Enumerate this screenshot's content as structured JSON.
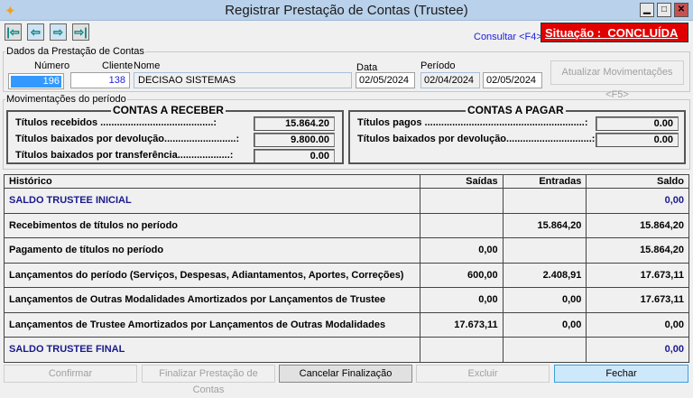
{
  "window": {
    "title": "Registrar Prestação de Contas (Trustee)",
    "minimize": "▁",
    "maximize": "□",
    "close": "✕"
  },
  "nav": {
    "first": "|⇦",
    "prev": "⇦",
    "next": "⇨",
    "last": "⇨|"
  },
  "consultar": "Consultar <F4>",
  "situacao": {
    "label": "Situação :",
    "value": "CONCLUÍDA",
    "color": "#e00000"
  },
  "dados": {
    "group": "Dados da Prestação de Contas",
    "numero_label": "Número",
    "numero": "196",
    "cliente_label": "Cliente",
    "cliente": "138",
    "nome_label": "Nome",
    "nome": "DECISAO SISTEMAS",
    "data_label": "Data",
    "data": "02/05/2024",
    "periodo_label": "Período",
    "periodo_ini": "02/04/2024",
    "periodo_fim": "02/05/2024",
    "atualizar": "Atualizar Movimentações <F5>"
  },
  "mov": {
    "group": "Movimentações do período",
    "receber": {
      "title": "CONTAS A RECEBER",
      "rows": [
        {
          "label": "Títulos recebidos .........................................:",
          "value": "15.864.20"
        },
        {
          "label": "Títulos baixados por devolução..........................:",
          "value": "9.800.00"
        },
        {
          "label": "Títulos baixados por transferência...................:",
          "value": "0.00"
        }
      ]
    },
    "pagar": {
      "title": "CONTAS A PAGAR",
      "rows": [
        {
          "label": "Títulos pagos ..........................................................:",
          "value": "0.00"
        },
        {
          "label": "Títulos baixados por devolução...............................:",
          "value": "0.00"
        }
      ]
    }
  },
  "table": {
    "headers": [
      "Histórico",
      "Saídas",
      "Entradas",
      "Saldo"
    ],
    "rows": [
      [
        "SALDO TRUSTEE INICIAL",
        "",
        "",
        "0,00"
      ],
      [
        "Recebimentos de títulos no período",
        "",
        "15.864,20",
        "15.864,20"
      ],
      [
        "Pagamento de títulos no período",
        "0,00",
        "",
        "15.864,20"
      ],
      [
        "Lançamentos do período (Serviços, Despesas, Adiantamentos, Aportes, Correções)",
        "600,00",
        "2.408,91",
        "17.673,11"
      ],
      [
        "Lançamentos de Outras Modalidades Amortizados por Lançamentos de Trustee",
        "0,00",
        "0,00",
        "17.673,11"
      ],
      [
        "Lançamentos de Trustee Amortizados por Lançamentos de Outras Modalidades",
        "17.673,11",
        "0,00",
        "0,00"
      ],
      [
        "SALDO TRUSTEE FINAL",
        "",
        "",
        "0,00"
      ]
    ]
  },
  "buttons": {
    "confirmar": "Confirmar",
    "finalizar": "Finalizar Prestação de Contas",
    "cancelar": "Cancelar Finalização",
    "excluir": "Excluir",
    "fechar": "Fechar"
  }
}
